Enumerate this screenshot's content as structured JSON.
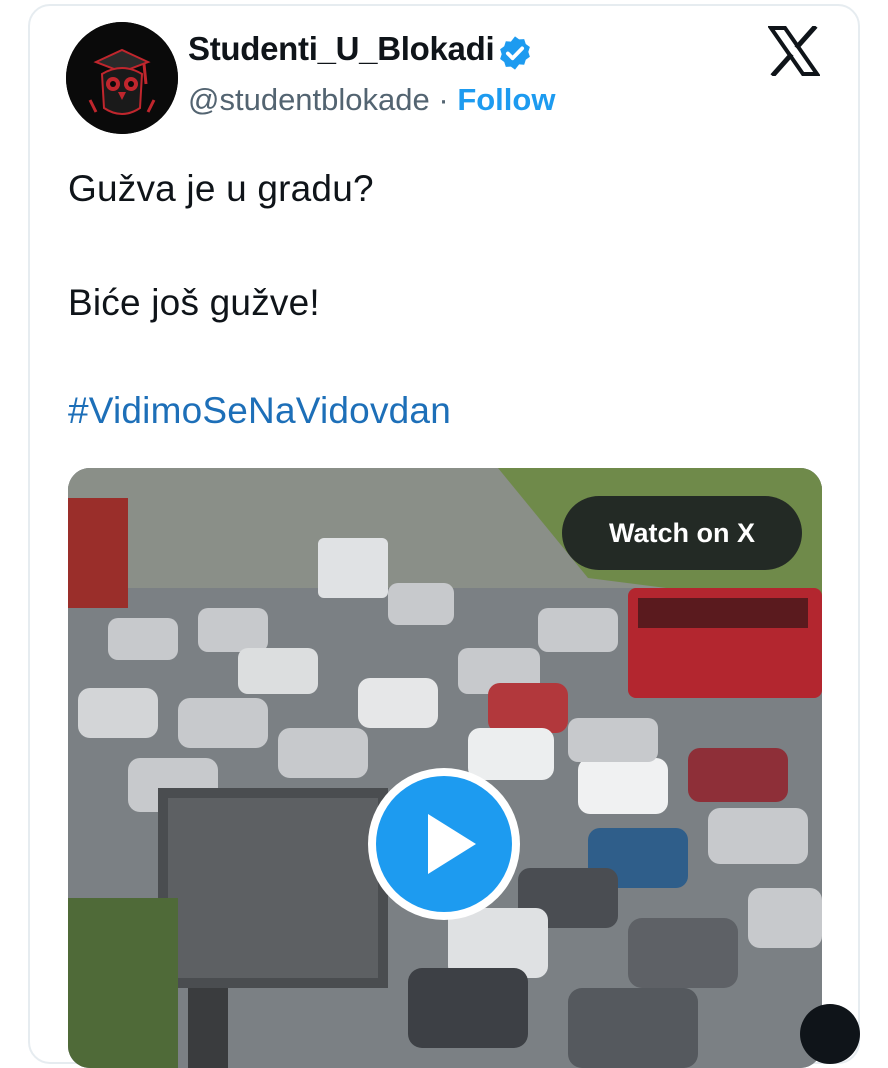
{
  "tweet": {
    "display_name": "Studenti_U_Blokadi",
    "handle": "@studentblokade",
    "separator": " · ",
    "follow_label": "Follow",
    "text_line1": "Gužva je u gradu?",
    "text_line2": "Biće još gužve!",
    "hashtag": "#VidimoSeNaVidovdan"
  },
  "media": {
    "watch_label": "Watch on X",
    "thumbnail": "traffic-jam-video-thumbnail"
  },
  "icons": {
    "verified": "verified-badge-icon",
    "brand": "x-logo-icon",
    "play": "play-icon"
  },
  "colors": {
    "accent": "#1d9bf0",
    "link": "#1d6fb8",
    "text": "#0f1419",
    "muted": "#536471",
    "border": "#e6ecf0"
  }
}
